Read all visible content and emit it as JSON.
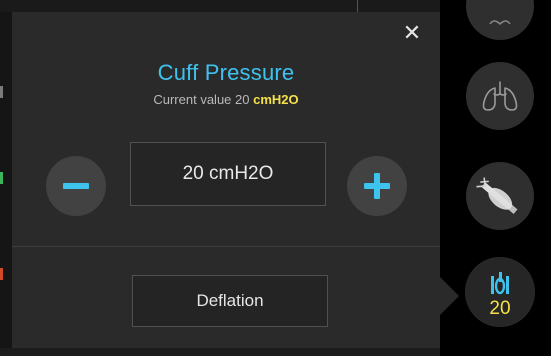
{
  "popup": {
    "title": "Cuff Pressure",
    "subtitle_prefix": "Current value 20 ",
    "subtitle_unit": "cmH2O",
    "value_display": "20 cmH2O",
    "deflation_label": "Deflation",
    "close_icon": "close-icon",
    "minus_icon": "minus-icon",
    "plus_icon": "plus-icon"
  },
  "side_menu": {
    "items": [
      {
        "icon": "partial-icon",
        "label": ""
      },
      {
        "icon": "lungs-icon",
        "label": ""
      },
      {
        "icon": "cuffed-tube-icon",
        "label": ""
      },
      {
        "icon": "cuff-pressure-icon",
        "label": "20",
        "active": true
      }
    ]
  },
  "colors": {
    "accent": "#3ec3ef",
    "highlight": "#f5e04a",
    "panel": "#2a2a2a",
    "background": "#000000"
  }
}
